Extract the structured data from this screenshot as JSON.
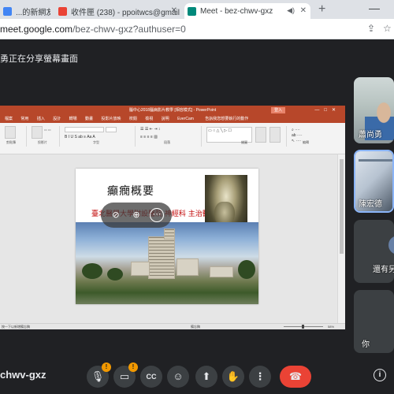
{
  "browser": {
    "tabs": [
      {
        "title": "...的新網友紀錄",
        "favicon_color": "#4285f4",
        "active": false
      },
      {
        "title": "收件匣 (238) - ppoitwcs@gmail",
        "favicon_color": "#ea4335",
        "active": false
      },
      {
        "title": "Meet - bez-chwv-gxz",
        "favicon_color": "#00897b",
        "active": true
      }
    ],
    "new_tab_label": "+",
    "url_host": "meet.google.com",
    "url_path": "/bez-chwv-gxz?authuser=0"
  },
  "meet": {
    "presenting_banner": "勇正在分享螢幕畫面",
    "meeting_code": "chwv-gxz",
    "participants": [
      {
        "name": "蕭尚勇"
      },
      {
        "name": "陳宏德"
      },
      {
        "name": "還有另"
      },
      {
        "name": "你"
      }
    ],
    "controls": {
      "mic_badge": "!",
      "cam_badge": "!"
    }
  },
  "powerpoint": {
    "title_bar": "腦中心2018腦病影片教學 [相容模式] - PowerPoint",
    "sign_in": "登入",
    "menu": [
      "檔案",
      "常用",
      "插入",
      "設計",
      "轉場",
      "動畫",
      "投影片放映",
      "校閱",
      "檢視",
      "說明",
      "EverCam",
      "告訴我您想要執行的動作"
    ],
    "ribbon_groups": [
      "剪貼簿",
      "投影片",
      "字型",
      "段落",
      "繪圖",
      "編輯"
    ],
    "status_left": "按一下以新增備忘稿",
    "status_right": "備忘稿",
    "zoom": "58%"
  },
  "slide": {
    "title": "癲癇概要",
    "subtitle": "臺北醫學大學附設醫院 神經科 主治醫師"
  },
  "colors": {
    "accent": "#ea4335",
    "powerpoint": "#b7472a",
    "highlight": "#8ab4f8"
  }
}
